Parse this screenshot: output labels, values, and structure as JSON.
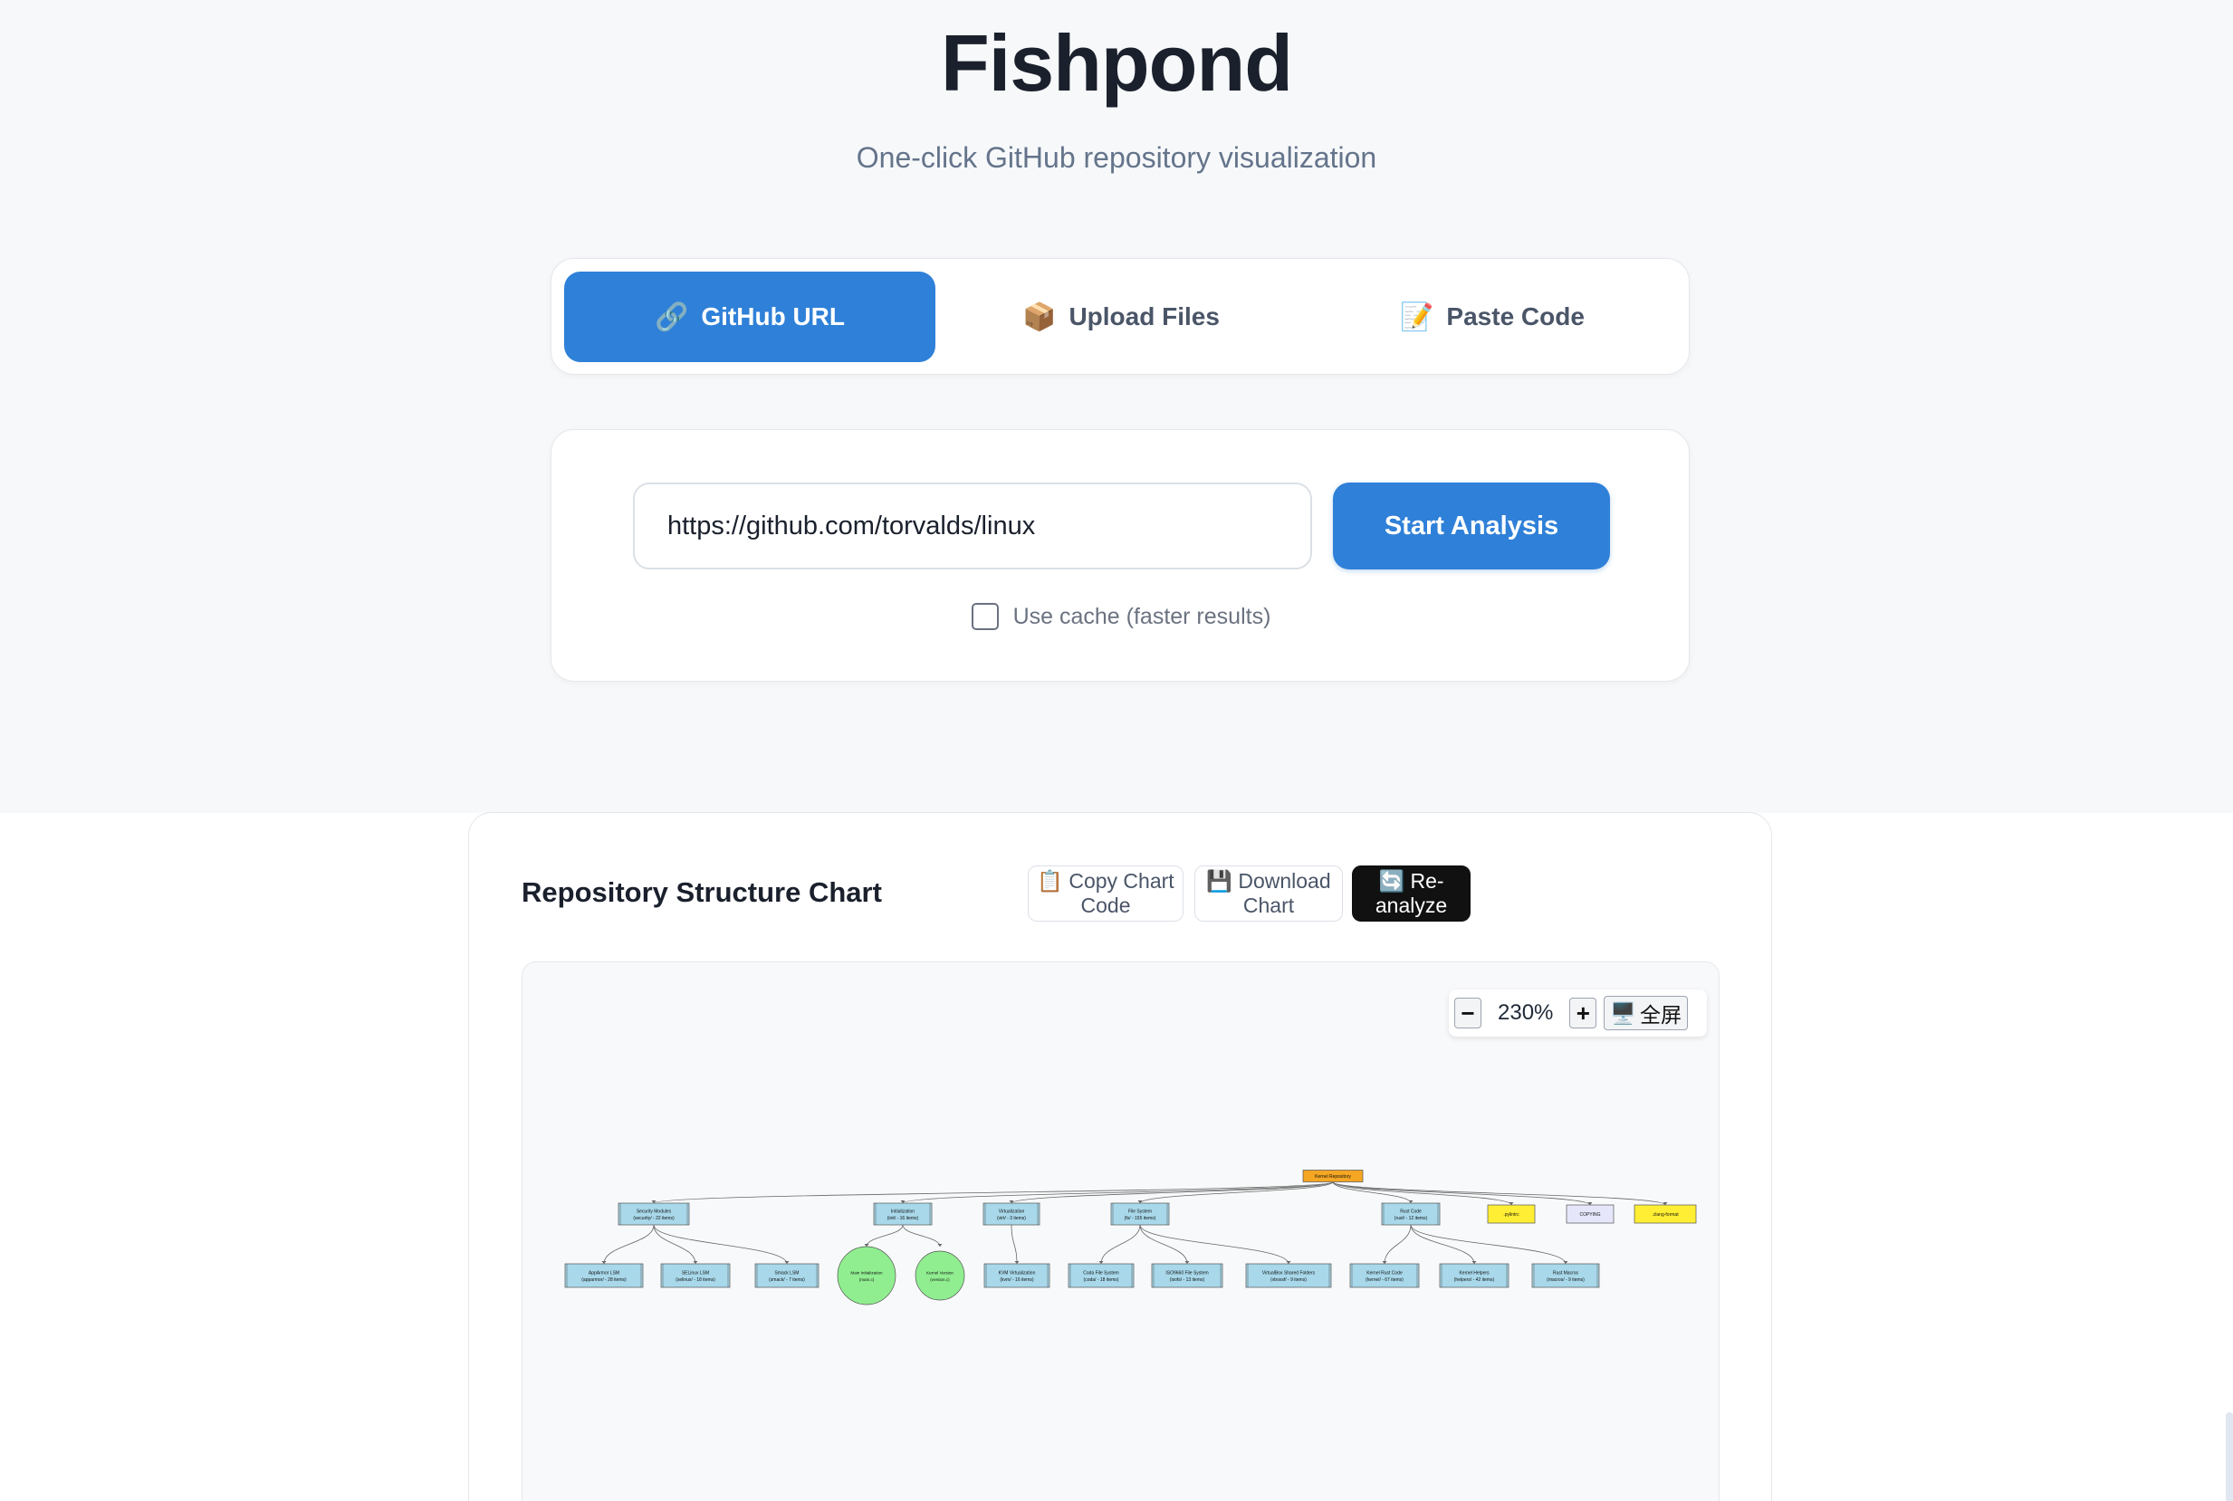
{
  "app": {
    "title": "Fishpond",
    "subtitle": "One-click GitHub repository visualization"
  },
  "tabs": [
    {
      "icon": "🔗",
      "label": "GitHub URL",
      "active": true
    },
    {
      "icon": "📦",
      "label": "Upload Files",
      "active": false
    },
    {
      "icon": "📝",
      "label": "Paste Code",
      "active": false
    }
  ],
  "url_form": {
    "input_value": "https://github.com/torvalds/linux",
    "submit_label": "Start Analysis",
    "cache_label": "Use cache (faster results)",
    "cache_checked": false
  },
  "chart_panel": {
    "title": "Repository Structure Chart",
    "copy_label": "📋 Copy Chart Code",
    "download_label": "💾 Download Chart",
    "reanalyze_label": "🔄 Re-analyze",
    "zoom": {
      "minus": "−",
      "level": "230%",
      "plus": "+",
      "fullscreen_icon": "🖥️",
      "fullscreen_label": "全屏"
    }
  },
  "diagram": {
    "root": {
      "id": "root",
      "label": "Kernel Repository",
      "kind": "root"
    },
    "level1": [
      {
        "id": "sec",
        "label": "Security Modules",
        "sub": "(security/ - 22 items)",
        "kind": "dir"
      },
      {
        "id": "init",
        "label": "Initialization",
        "sub": "(init/ - 16 items)",
        "kind": "dir"
      },
      {
        "id": "virt",
        "label": "Virtualization",
        "sub": "(virt/ - 3 items)",
        "kind": "dir"
      },
      {
        "id": "fs",
        "label": "File System",
        "sub": "(fs/ - 155 items)",
        "kind": "dir"
      },
      {
        "id": "rust",
        "label": "Rust Code",
        "sub": "(rust/ - 12 items)",
        "kind": "dir"
      },
      {
        "id": "pylintrc",
        "label": ".pylintrc",
        "kind": "config"
      },
      {
        "id": "copying",
        "label": "COPYING",
        "kind": "license"
      },
      {
        "id": "clangformat",
        "label": ".clang-format",
        "kind": "config"
      }
    ],
    "level2": [
      {
        "id": "apparmor",
        "parent": "sec",
        "label": "AppArmor LSM",
        "sub": "(apparmor/ - 28 items)",
        "kind": "dir"
      },
      {
        "id": "selinux",
        "parent": "sec",
        "label": "SELinux LSM",
        "sub": "(selinux/ - 18 items)",
        "kind": "dir"
      },
      {
        "id": "smack",
        "parent": "sec",
        "label": "Smack LSM",
        "sub": "(smack/ - 7 items)",
        "kind": "dir"
      },
      {
        "id": "mainc",
        "parent": "init",
        "label": "Main Initialization",
        "sub": "(main.c)",
        "kind": "file"
      },
      {
        "id": "versionc",
        "parent": "init",
        "label": "Kernel Version",
        "sub": "(version.c)",
        "kind": "file"
      },
      {
        "id": "kvm",
        "parent": "virt",
        "label": "KVM Virtualization",
        "sub": "(kvm/ - 16 items)",
        "kind": "dir"
      },
      {
        "id": "coda",
        "parent": "fs",
        "label": "Coda File System",
        "sub": "(coda/ - 18 items)",
        "kind": "dir"
      },
      {
        "id": "isofs",
        "parent": "fs",
        "label": "ISO9660 File System",
        "sub": "(isofs/ - 13 items)",
        "kind": "dir"
      },
      {
        "id": "vboxsf",
        "parent": "fs",
        "label": "VirtualBox Shared Folders",
        "sub": "(vboxsf/ - 9 items)",
        "kind": "dir"
      },
      {
        "id": "kernel",
        "parent": "rust",
        "label": "Kernel Rust Code",
        "sub": "(kernel/ - 67 items)",
        "kind": "dir"
      },
      {
        "id": "helpers",
        "parent": "rust",
        "label": "Kernel Helpers",
        "sub": "(helpers/ - 42 items)",
        "kind": "dir"
      },
      {
        "id": "macros",
        "parent": "rust",
        "label": "Rust Macros",
        "sub": "(macros/ - 9 items)",
        "kind": "dir"
      }
    ],
    "colors": {
      "root": "#f5a623",
      "dir": "#a8d8ea",
      "file": "#90ee90",
      "config": "#ffee33",
      "license": "#e6e6fa",
      "edge": "#666666",
      "brand_blue": "#2f80d8"
    }
  }
}
